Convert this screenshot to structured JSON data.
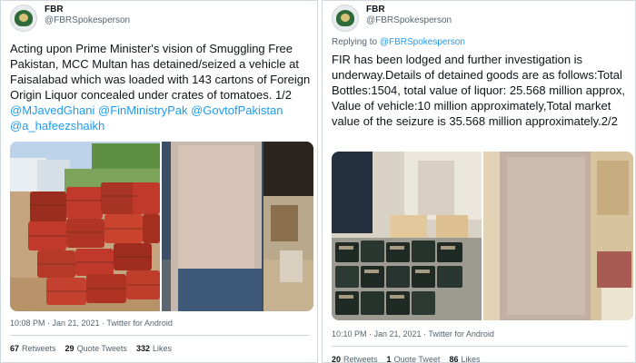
{
  "tweets": [
    {
      "display_name": "FBR",
      "handle": "@FBRSpokesperson",
      "text_plain": "Acting upon Prime Minister's vision of Smuggling Free Pakistan, MCC Multan has detained/seized a vehicle at Faisalabad which was loaded with 143 cartons of Foreign Origin Liquor concealed under crates of tomatoes. 1/2 ",
      "mentions": [
        "@MJavedGhani",
        "@FinMinistryPak",
        "@GovtofPakistan",
        "@a_hafeezshaikh"
      ],
      "timestamp": "10:08 PM · Jan 21, 2021 · Twitter for Android",
      "retweets_count": "67",
      "retweets_label": "Retweets",
      "quotes_count": "29",
      "quotes_label": "Quote Tweets",
      "likes_count": "332",
      "likes_label": "Likes",
      "media": [
        "tomato-crates-photo",
        "blurred-face-photo",
        "cartons-photo"
      ]
    },
    {
      "display_name": "FBR",
      "handle": "@FBRSpokesperson",
      "replying_to_prefix": "Replying to",
      "replying_to_handle": "@FBRSpokesperson",
      "text_plain": "FIR has been lodged and further investigation is underway.Details of detained goods are as follows:Total Bottles:1504, total value of liquor: 25.568 million approx, Value of vehicle:10 million approximately,Total market value of the seizure is 35.568 million approximately.2/2",
      "timestamp": "10:10 PM · Jan 21, 2021 · Twitter for Android",
      "retweets_count": "20",
      "retweets_label": "Retweets",
      "quotes_count": "1",
      "quotes_label": "Quote Tweet",
      "likes_count": "86",
      "likes_label": "Likes",
      "media": [
        "liquor-bottles-photo",
        "blurred-face-photo"
      ]
    }
  ],
  "colors": {
    "link": "#1d9bf0",
    "text": "#0f1419",
    "muted": "#536471",
    "border": "#cfd9de"
  }
}
